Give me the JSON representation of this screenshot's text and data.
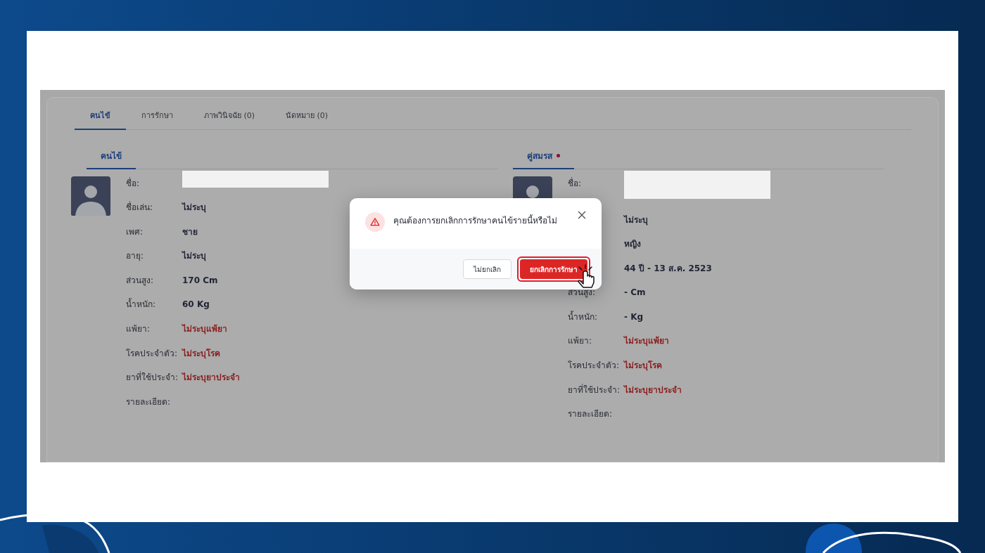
{
  "tabs": [
    {
      "label": "คนไข้",
      "selected": true
    },
    {
      "label": "การรักษา",
      "selected": false
    },
    {
      "label": "ภาพวินิจฉัย (0)",
      "selected": false
    },
    {
      "label": "นัดหมาย (0)",
      "selected": false
    }
  ],
  "panels": [
    {
      "header": "คนไข้",
      "dot": false,
      "name_label": "ชื่อ:",
      "rows": [
        {
          "label": "ชื่อเล่น:",
          "value": "ไม่ระบุ",
          "kind": "plain"
        },
        {
          "label": "เพศ:",
          "value": "ชาย",
          "kind": "plain"
        },
        {
          "label": "อายุ:",
          "value": "ไม่ระบุ",
          "kind": "plain"
        },
        {
          "label": "ส่วนสูง:",
          "value": "170 Cm",
          "kind": "plain"
        },
        {
          "label": "น้ำหนัก:",
          "value": "60 Kg",
          "kind": "plain"
        },
        {
          "label": "แพ้ยา:",
          "value": "ไม่ระบุแพ้ยา",
          "kind": "warning"
        },
        {
          "label": "โรคประจำตัว:",
          "value": "ไม่ระบุโรค",
          "kind": "warning"
        },
        {
          "label": "ยาที่ใช้ประจำ:",
          "value": "ไม่ระบุยาประจำ",
          "kind": "warning"
        },
        {
          "label": "รายละเอียด:"
        }
      ]
    },
    {
      "header": "คู่สมรส",
      "dot": true,
      "name_label": "ชื่อ:",
      "rows": [
        {
          "value": "ไม่ระบุ",
          "kind": "plain"
        },
        {
          "value": "หญิง",
          "kind": "plain"
        },
        {
          "value": "44 ปี - 13 ส.ค. 2523",
          "kind": "plain"
        },
        {
          "label": "ส่วนสูง:",
          "value": "- Cm",
          "kind": "plain"
        },
        {
          "label": "น้ำหนัก:",
          "value": "- Kg",
          "kind": "plain"
        },
        {
          "label": "แพ้ยา:",
          "value": "ไม่ระบุแพ้ยา",
          "kind": "warning"
        },
        {
          "label": "โรคประจำตัว:",
          "value": "ไม่ระบุโรค",
          "kind": "warning"
        },
        {
          "label": "ยาที่ใช้ประจำ:",
          "value": "ไม่ระบุยาประจำ",
          "kind": "warning"
        },
        {
          "label": "รายละเอียด:"
        }
      ]
    }
  ],
  "dialog": {
    "message": "คุณต้องการยกเลิกการรักษาคนไข้รายนี้หรือไม่",
    "buttons": [
      {
        "label": "ไม่ยกเลิก",
        "kind": "secondary"
      },
      {
        "label": "ยกเลิกการรักษา",
        "kind": "danger"
      }
    ]
  }
}
